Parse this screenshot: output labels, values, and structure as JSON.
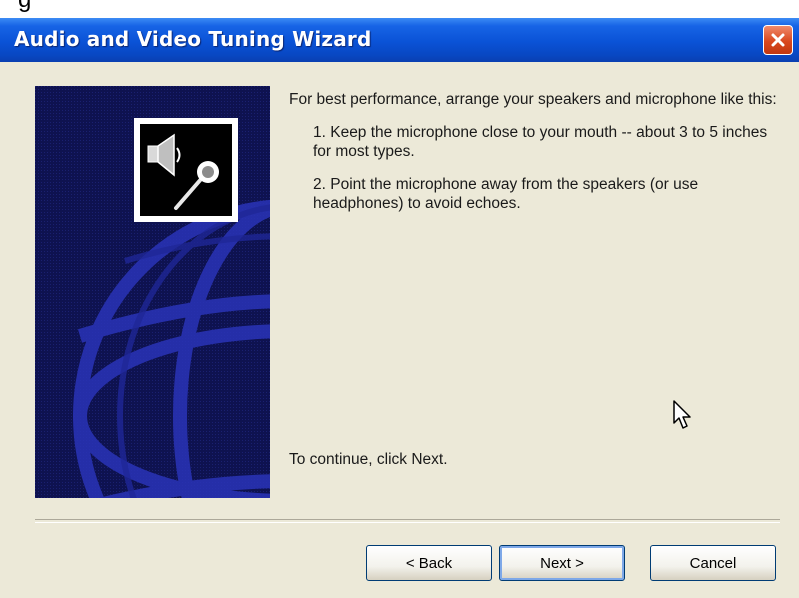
{
  "top_text": "g",
  "window": {
    "title": "Audio and Video Tuning Wizard"
  },
  "icons": {
    "close": "close-icon",
    "speaker": "speaker-icon",
    "microphone": "microphone-icon",
    "cursor": "mouse-cursor-icon"
  },
  "content": {
    "intro": "For best performance, arrange your speakers and microphone like this:",
    "step1": "1. Keep the microphone close to your mouth -- about 3 to 5 inches for most types.",
    "step2": "2. Point the microphone away from the speakers (or use headphones) to avoid echoes.",
    "continue": "To continue, click Next."
  },
  "buttons": {
    "back": "< Back",
    "next": "Next >",
    "cancel": "Cancel"
  },
  "colors": {
    "titlebar": "#0a52d6",
    "close_button": "#d9481f",
    "dialog_background": "#ece9d8",
    "side_panel": "#0e1250"
  }
}
